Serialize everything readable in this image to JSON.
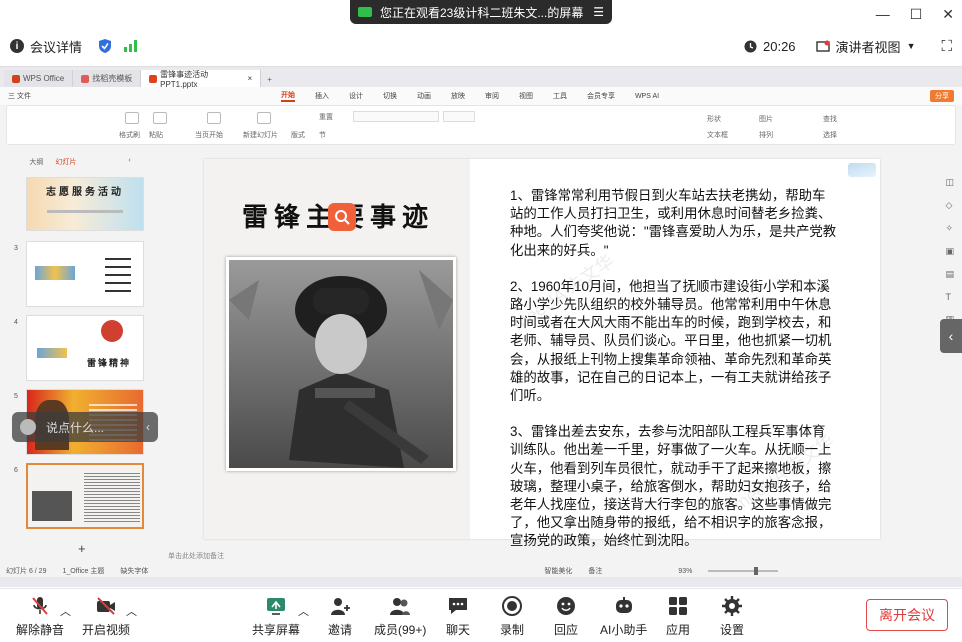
{
  "banner": {
    "text": "您正在观看23级计科二班朱文...的屏幕"
  },
  "window_controls": {
    "min": "—",
    "max": "☐",
    "close": "✕"
  },
  "meeting_bar": {
    "info_label": "会议详情",
    "clock": "20:26",
    "presenter_view": "演讲者视图"
  },
  "wps": {
    "tabs": [
      {
        "label": "WPS Office",
        "color": "#d0421b"
      },
      {
        "label": "找稻壳模板",
        "color": "#e05a5a"
      },
      {
        "label": "雷锋事迹活动PPT1.pptx",
        "color": "#e0431b"
      }
    ],
    "file_menu": "三 文件",
    "menus": [
      "开始",
      "插入",
      "设计",
      "切换",
      "动画",
      "放映",
      "审阅",
      "视图",
      "工具",
      "会员专享"
    ],
    "active_menu": "开始",
    "wps_ai": "WPS AI",
    "share": "分享",
    "ribbon": {
      "format_painter": "格式刷",
      "paste": "粘贴",
      "current_slide": "当页开始",
      "new_slide": "新建幻灯片",
      "layout": "版式",
      "section": "节",
      "reset": "重置",
      "shapes": "形状",
      "picture": "图片",
      "textbox": "文本框",
      "arrange": "排列",
      "find": "查找",
      "select": "选择"
    },
    "left_panel": {
      "tabs": [
        "大纲",
        "幻灯片"
      ],
      "active": "幻灯片",
      "slides": [
        {
          "num": "",
          "title": "志愿服务活动"
        },
        {
          "num": "3",
          "title": ""
        },
        {
          "num": "4",
          "title": "雷锋精神"
        },
        {
          "num": "5",
          "title": ""
        },
        {
          "num": "6",
          "title": ""
        }
      ],
      "add_symbol": "+"
    },
    "slide": {
      "title": "雷锋主要事迹",
      "paragraphs": [
        "1、雷锋常常利用节假日到火车站去扶老携幼，帮助车站的工作人员打扫卫生，或利用休息时间替老乡捡粪、种地。人们夸奖他说：\"雷锋喜爱助人为乐，是共产党教化出来的好兵。\"",
        "2、1960年10月间，他担当了抚顺市建设街小学和本溪路小学少先队组织的校外辅导员。他常常利用中午休息时间或者在大风大雨不能出车的时候，跑到学校去，和老师、辅导员、队员们谈心。平日里，他也抓紧一切机会，从报纸上刊物上搜集革命领袖、革命先烈和革命英雄的故事，记在自己的日记本上，一有工夫就讲给孩子们听。",
        "3、雷锋出差去安东，去参与沈阳部队工程兵军事体育训练队。他出差一千里，好事做了一火车。从抚顺一上火车，他看到列车员很忙，就动手干了起来擦地板，擦玻璃，整理小桌子，给旅客倒水，帮助妇女抱孩子，给老年人找座位，接送背大行李包的旅客。这些事情做完了，他又拿出随身带的报纸，给不相识字的旅客念报，宣扬党的政策，始终忙到沈阳。"
      ]
    },
    "notes": "单击此处添加备注",
    "status": {
      "slide_count": "幻灯片 6 / 29",
      "theme": "1_Office 主题",
      "font_missing": "缺失字体",
      "smart": "智能美化",
      "notes_btn": "备注",
      "zoom": "93%"
    }
  },
  "chat_pill": {
    "placeholder": "说点什么..."
  },
  "bottom_bar": {
    "items": [
      {
        "label": "解除静音",
        "icon": "mic-muted-icon"
      },
      {
        "label": "开启视频",
        "icon": "camera-off-icon"
      },
      {
        "label": "共享屏幕",
        "icon": "share-screen-icon"
      },
      {
        "label": "邀请",
        "icon": "invite-icon"
      },
      {
        "label": "成员(99+)",
        "icon": "members-icon"
      },
      {
        "label": "聊天",
        "icon": "chat-icon"
      },
      {
        "label": "录制",
        "icon": "record-icon"
      },
      {
        "label": "回应",
        "icon": "reaction-icon"
      },
      {
        "label": "AI小助手",
        "icon": "ai-assistant-icon"
      },
      {
        "label": "应用",
        "icon": "apps-icon"
      },
      {
        "label": "设置",
        "icon": "settings-icon"
      }
    ],
    "leave": "离开会议"
  },
  "colors": {
    "accent": "#d0421b",
    "leave": "#e03a3a",
    "chart_green": "#2fbf4a",
    "shield_blue": "#2f6fe0"
  }
}
